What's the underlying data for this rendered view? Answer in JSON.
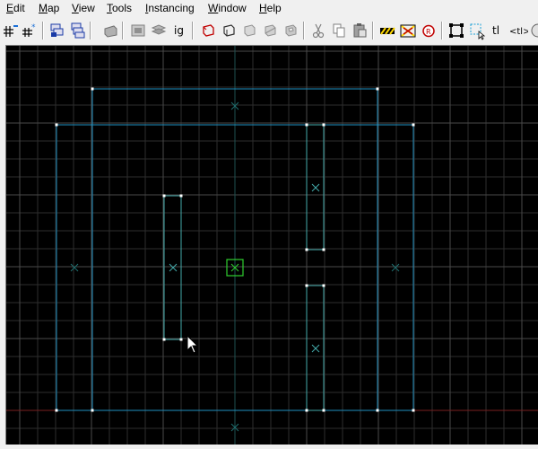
{
  "menu": {
    "edit": {
      "accel": "E",
      "rest": "dit"
    },
    "map": {
      "accel": "M",
      "rest": "ap"
    },
    "view": {
      "accel": "V",
      "rest": "iew"
    },
    "tools": {
      "accel": "T",
      "rest": "ools"
    },
    "instancing": {
      "accel": "I",
      "rest": "nstancing"
    },
    "window": {
      "accel": "W",
      "rest": "indow"
    },
    "help": {
      "accel": "H",
      "rest": "elp"
    }
  },
  "toolbar": {
    "ig_label": "ig",
    "tl_label": "tl",
    "tl2_label": "<tl>"
  },
  "colors": {
    "viewport_bg": "#000000",
    "grid_minor": "#2e2e2e",
    "grid_major": "#4a4a4a",
    "axis_x": "#7a2020",
    "axis_y": "#1e5050",
    "brush_outline": "#1f8fbf",
    "brush_selected": "#4aa",
    "handle": "#ffffff",
    "center_marker": "#1f6f6f",
    "origin_box": "#2fcf2f"
  },
  "icons": [
    "grid-toggle-icon",
    "grid-3d-toggle-icon",
    "group-icon",
    "ungroup-icon",
    "carve-icon",
    "hide-selected-icon",
    "show-all-icon",
    "ignore-groups-icon",
    "texture-lock-icon",
    "texture-app-icon",
    "hollow-icon",
    "clip-icon",
    "cut-icon",
    "copy-icon",
    "paste-icon",
    "hazard-icon",
    "hazard-x-icon",
    "record-icon",
    "select-box-icon",
    "select-cursor-icon",
    "tl-icon",
    "tl2-icon"
  ]
}
